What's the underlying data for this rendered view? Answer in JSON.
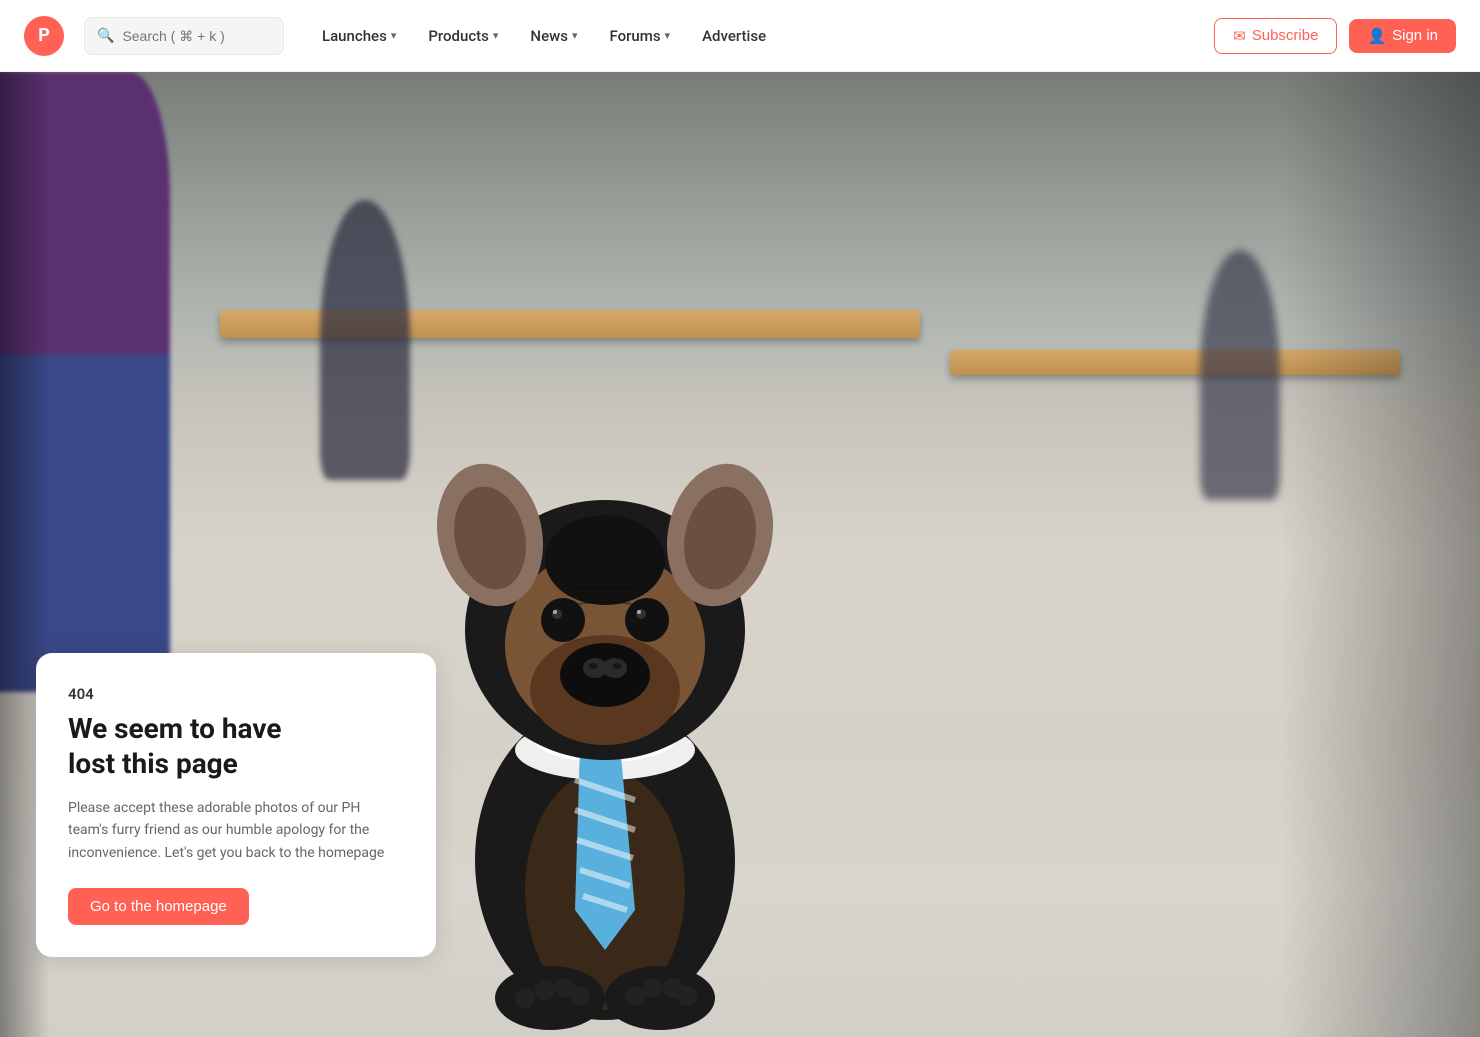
{
  "site": {
    "logo_letter": "P",
    "logo_bg": "#ff6154"
  },
  "navbar": {
    "search": {
      "placeholder": "Search ( ⌘ + k )"
    },
    "items": [
      {
        "id": "launches",
        "label": "Launches",
        "has_dropdown": true
      },
      {
        "id": "products",
        "label": "Products",
        "has_dropdown": true
      },
      {
        "id": "news",
        "label": "News",
        "has_dropdown": true
      },
      {
        "id": "forums",
        "label": "Forums",
        "has_dropdown": true
      },
      {
        "id": "advertise",
        "label": "Advertise",
        "has_dropdown": false
      }
    ],
    "subscribe_label": "Subscribe",
    "signin_label": "Sign in"
  },
  "error_page": {
    "code": "404",
    "title_line1": "We seem to have",
    "title_line2": "lost this page",
    "description": "Please accept these adorable photos of our PH team's furry friend as our humble apology for the inconvenience. Let's get you back to the homepage",
    "cta_label": "Go to the homepage"
  },
  "colors": {
    "accent": "#ff6154",
    "white": "#ffffff",
    "text_dark": "#1a1a1a",
    "text_medium": "#333333",
    "text_light": "#666666"
  }
}
